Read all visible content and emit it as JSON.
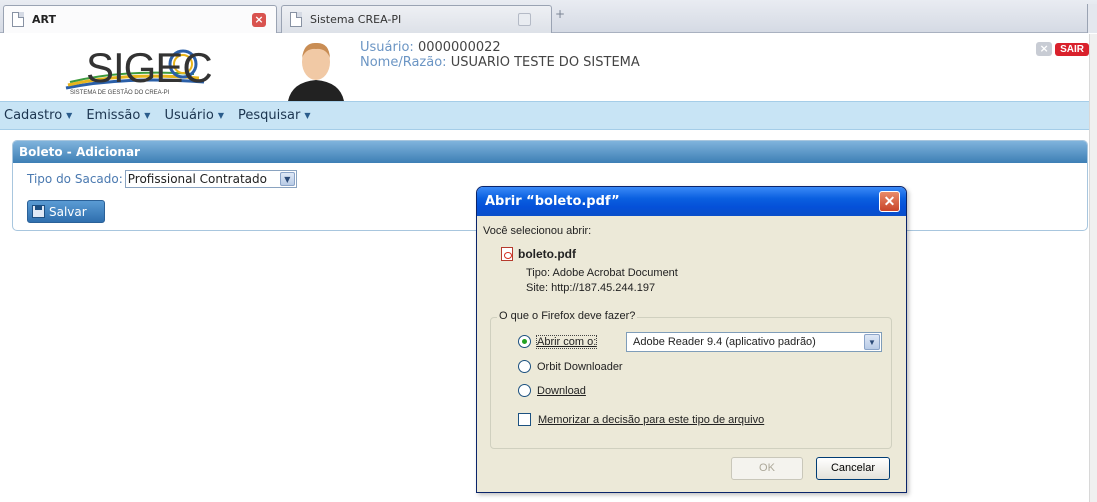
{
  "browser": {
    "tabs": [
      {
        "label": "ART",
        "active": true
      },
      {
        "label": "Sistema CREA-PI",
        "active": false
      }
    ],
    "new_tab_glyph": "+"
  },
  "header": {
    "logo_text": "SIGEC",
    "logo_caption": "SISTEMA DE GESTÃO DO CREA-PI",
    "user_label": "Usuário:",
    "user_value": "0000000022",
    "name_label": "Nome/Razão:",
    "name_value": "USUARIO TESTE DO SISTEMA",
    "logout_label": "SAIR"
  },
  "menu": {
    "items": [
      "Cadastro",
      "Emissão",
      "Usuário",
      "Pesquisar"
    ]
  },
  "panel": {
    "title": "Boleto - Adicionar",
    "sacado_label": "Tipo do Sacado:",
    "sacado_value": "Profissional Contratado",
    "save_label": "Salvar"
  },
  "dialog": {
    "title": "Abrir “boleto.pdf”",
    "selected_text": "Você selecionou abrir:",
    "file_name": "boleto.pdf",
    "type_label": "Tipo:",
    "type_value": "Adobe Acrobat Document",
    "site_label": "Site:",
    "site_value": "http://187.45.244.197",
    "question": "O que o Firefox deve fazer?",
    "options": [
      {
        "label": "Abrir com o:",
        "selected": true
      },
      {
        "label": "Orbit Downloader",
        "selected": false
      },
      {
        "label": "Download",
        "selected": false
      }
    ],
    "app_value": "Adobe Reader 9.4 (aplicativo padrão)",
    "remember_label": "Memorizar a decisão para este tipo de arquivo",
    "remember_checked": false,
    "ok_label": "OK",
    "cancel_label": "Cancelar"
  },
  "colors": {
    "menubar_bg": "#c8e4f5",
    "panel_header": "#3d7fb5",
    "dialog_title": "#0550d8",
    "sair_red": "#d9212c"
  }
}
